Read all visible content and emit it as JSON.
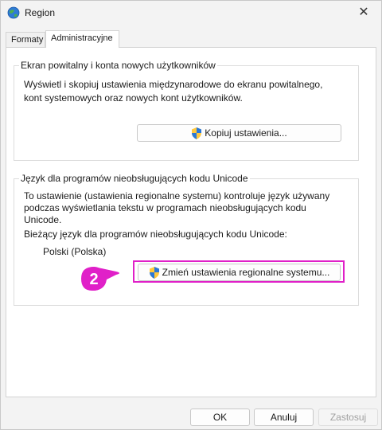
{
  "window": {
    "title": "Region",
    "close_label": "✕"
  },
  "tabs": [
    {
      "label": "Formaty"
    },
    {
      "label": "Administracyjne"
    }
  ],
  "welcome_group": {
    "title": "Ekran powitalny i konta nowych użytkowników",
    "description_line1": "Wyświetl i skopiuj ustawienia międzynarodowe do ekranu powitalnego,",
    "description_line2": "kont systemowych oraz nowych kont użytkowników.",
    "copy_button_label": "Kopiuj ustawienia..."
  },
  "unicode_group": {
    "title": "Język dla programów nieobsługujących kodu Unicode",
    "description_line1": "To ustawienie (ustawienia regionalne systemu) kontroluje język używany",
    "description_line2": "podczas wyświetlania tekstu w programach nieobsługujących kodu",
    "description_line3": "Unicode.",
    "current_label": "Bieżący język dla programów nieobsługujących kodu Unicode:",
    "current_value": "Polski (Polska)",
    "change_button_label": "Zmień ustawienia regionalne systemu..."
  },
  "callout": {
    "number": "2",
    "color": "#e020c8"
  },
  "footer": {
    "ok_label": "OK",
    "cancel_label": "Anuluj",
    "apply_label": "Zastosuj"
  }
}
